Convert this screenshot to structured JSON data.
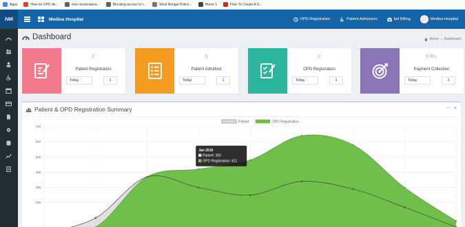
{
  "bookmarks": [
    {
      "label": "Apps",
      "color": "#4285f4"
    },
    {
      "label": "How do OPD de...",
      "color": "#e53935"
    },
    {
      "label": "new nourerawea...",
      "color": "#616161"
    },
    {
      "label": "Blocking access to t...",
      "color": "#616161"
    },
    {
      "label": "West Bengal Police...",
      "color": "#8d6e63"
    },
    {
      "label": "Home 1",
      "color": "#424242"
    },
    {
      "label": "How To Create A G...",
      "color": "#c62828"
    }
  ],
  "navbar": {
    "brand": "hMi",
    "hospital_name": "Medina Hospital",
    "links": [
      {
        "label": "OPD Registration",
        "icon": "clock-icon"
      },
      {
        "label": "Patient Admission",
        "icon": "wheelchair-icon"
      },
      {
        "label": "Ipd Billing",
        "icon": "camera-icon"
      }
    ],
    "user": "Medina Hospital"
  },
  "page": {
    "title": "Dashboard",
    "breadcrumb": [
      "Home",
      "Dashboard"
    ]
  },
  "cards": [
    {
      "number": "0",
      "label": "Patient Registration",
      "period": "Today",
      "count": "1",
      "color": "#f27a8c",
      "icon": "registration-icon"
    },
    {
      "number": "0",
      "label": "Patient Admitted",
      "period": "Today",
      "count": "1",
      "color": "#f39c20",
      "icon": "list-icon"
    },
    {
      "number": "0",
      "label": "OPD Registration",
      "period": "Today",
      "count": "1",
      "color": "#2bb59c",
      "icon": "checklist-icon"
    },
    {
      "number": "0 Rs.",
      "label": "Payment Collection",
      "period": "Today",
      "count": "1",
      "color": "#8b74b8",
      "icon": "target-icon"
    }
  ],
  "panel": {
    "title": "Patient & OPD Registration Summary",
    "tools": [
      "−",
      "×"
    ]
  },
  "chart_data": {
    "type": "area",
    "title": "Patient & OPD Registration Summary",
    "x_visible": [
      "",
      "",
      "",
      "Jan 2019",
      "",
      "",
      "",
      "",
      ""
    ],
    "series": [
      {
        "name": "Patient",
        "color": "#dddddd",
        "values": [
          0,
          100,
          370,
          300,
          250,
          340,
          290,
          170,
          40
        ]
      },
      {
        "name": "OPD Registration",
        "color": "#6fbf4a",
        "values": [
          0,
          40,
          370,
          421,
          480,
          640,
          580,
          300,
          80
        ]
      }
    ],
    "ylim": [
      0,
      700
    ],
    "yticks": [
      200,
      300,
      400,
      500,
      600,
      700
    ],
    "tooltip": {
      "title": "Jan 2019",
      "lines": [
        "Patient: 300",
        "OPD Registration: 421"
      ]
    },
    "grid": true,
    "legend": "top"
  }
}
